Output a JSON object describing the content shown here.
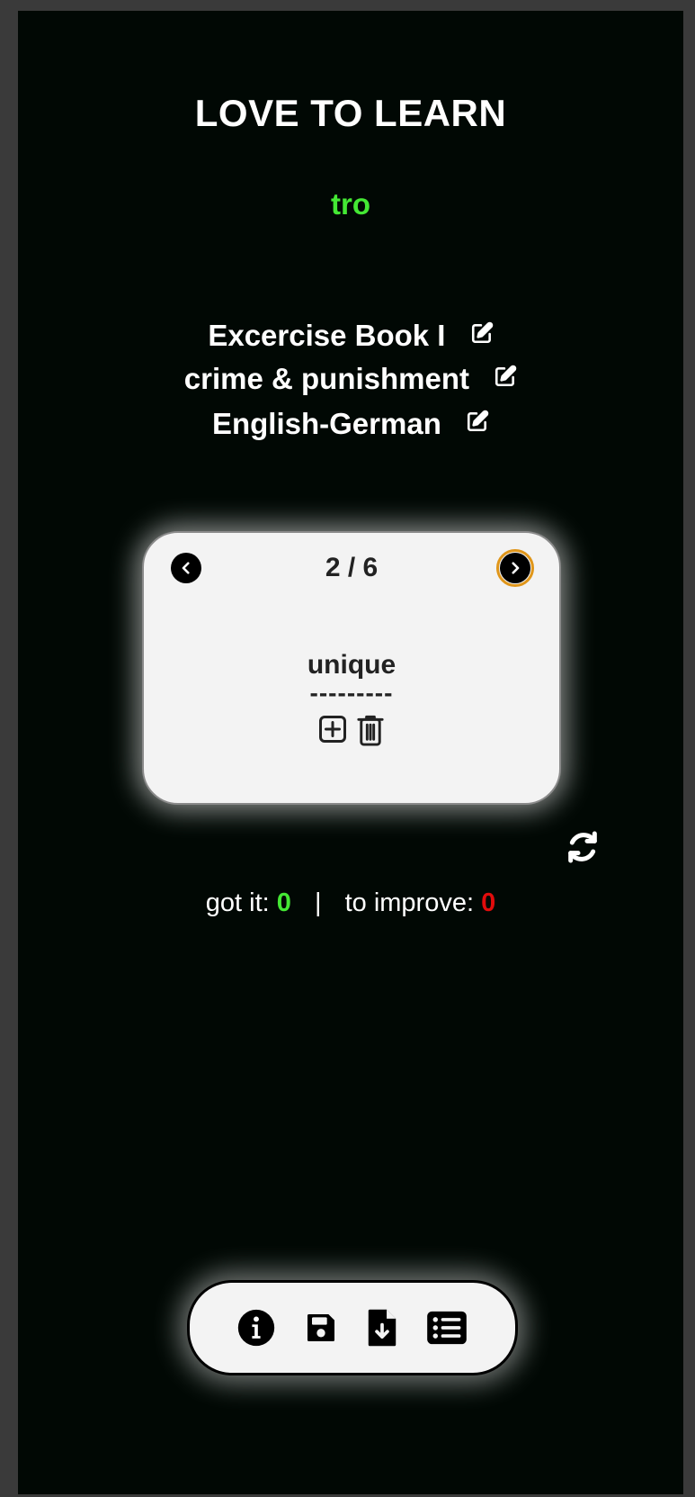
{
  "app": {
    "title": "LOVE TO LEARN",
    "username": "tro",
    "colors": {
      "background": "#010804",
      "username": "#44e834",
      "got_it": "#44e834",
      "to_improve": "#e10c0c",
      "card": "#f3f3f3",
      "focus_outline": "#e0961a"
    }
  },
  "meta": {
    "book": "Excercise Book I",
    "topic": "crime & punishment",
    "languages": "English-German",
    "edit_icon": "edit-icon"
  },
  "card": {
    "counter": "2 / 6",
    "word": "unique",
    "separator": "---------",
    "icons": {
      "prev": "chevron-left-icon",
      "next": "chevron-right-icon",
      "add": "plus-square-icon",
      "delete": "trash-icon"
    }
  },
  "refresh_icon": "refresh-icon",
  "score": {
    "got_it_label": "got it:",
    "got_it_value": "0",
    "separator": "|",
    "to_improve_label": "to improve:",
    "to_improve_value": "0"
  },
  "toolbar": {
    "icons": [
      "info-icon",
      "save-icon",
      "file-download-icon",
      "list-icon"
    ]
  }
}
